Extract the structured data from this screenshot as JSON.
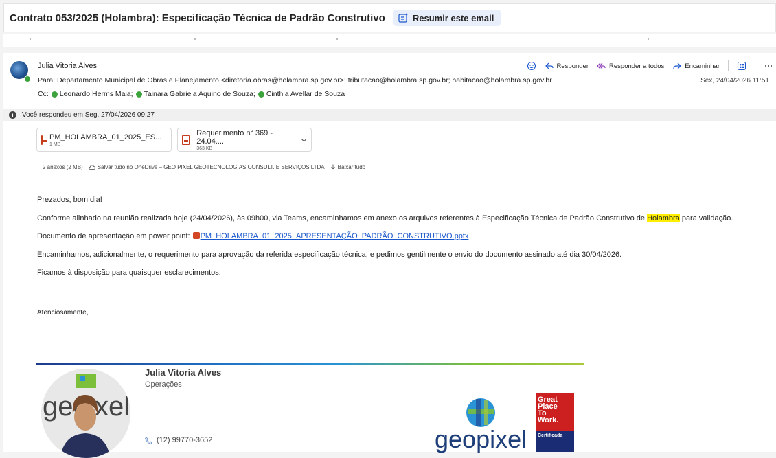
{
  "subject": "Contrato 053/2025 (Holambra): Especificação Técnica de Padrão Construtivo",
  "summarize_label": "Resumir este email",
  "header": {
    "sender": "Julia Vitoria Alves",
    "to_label": "Para:",
    "to_recipients": "Departamento Municipal de Obras e Planejamento <diretoria.obras@holambra.sp.gov.br>;  tributacao@holambra.sp.gov.br;  habitacao@holambra.sp.gov.br",
    "cc_label": "Cc:",
    "cc": [
      "Leonardo Herms Maia;",
      "Tainara Gabriela Aquino de Souza;",
      "Cinthia Avellar de Souza"
    ],
    "date": "Sex, 24/04/2026 11:51",
    "actions": {
      "reply": "Responder",
      "reply_all": "Responder a todos",
      "forward": "Encaminhar"
    }
  },
  "replied_notice": "Você respondeu em Seg, 27/04/2026 09:27",
  "attachments": [
    {
      "name": "PM_HOLAMBRA_01_2025_ES...",
      "size": "1 MB"
    },
    {
      "name": "Requerimento n° 369 - 24.04....",
      "size": "363 KB"
    }
  ],
  "attachments_meta": {
    "count": "2 anexos (2 MB)",
    "save_onedrive": "Salvar tudo no OneDrive – GEO PIXEL GEOTECNOLOGIAS CONSULT. E SERVIÇOS LTDA",
    "download_all": "Baixar tudo"
  },
  "body": {
    "greeting": "Prezados, bom dia!",
    "p1_before": "Conforme alinhado na reunião realizada hoje (24/04/2026), às 09h00, via Teams, encaminhamos em anexo os arquivos referentes à Especificação Técnica de Padrão Construtivo de ",
    "p1_highlight": "Holambra",
    "p1_after": " para validação.",
    "p2_label": "Documento de apresentação em power point:",
    "p2_link": "PM_HOLAMBRA_01_2025_APRESENTAÇÃO_PADRÃO_CONSTRUTIVO.pptx",
    "p3": "Encaminhamos, adicionalmente, o requerimento para aprovação da referida especificação técnica, e pedimos gentilmente o envio do documento assinado até dia 30/04/2026.",
    "p4": "Ficamos à disposição para quaisquer esclarecimentos.",
    "closing": "Atenciosamente,"
  },
  "signature": {
    "name": "Julia Vitoria Alves",
    "role": "Operações",
    "phone": "(12) 99770-3652",
    "logo_text": "geopixel",
    "gptw_lines": [
      "Great",
      "Place",
      "To",
      "Work."
    ],
    "gptw_cert": "Certificada"
  }
}
